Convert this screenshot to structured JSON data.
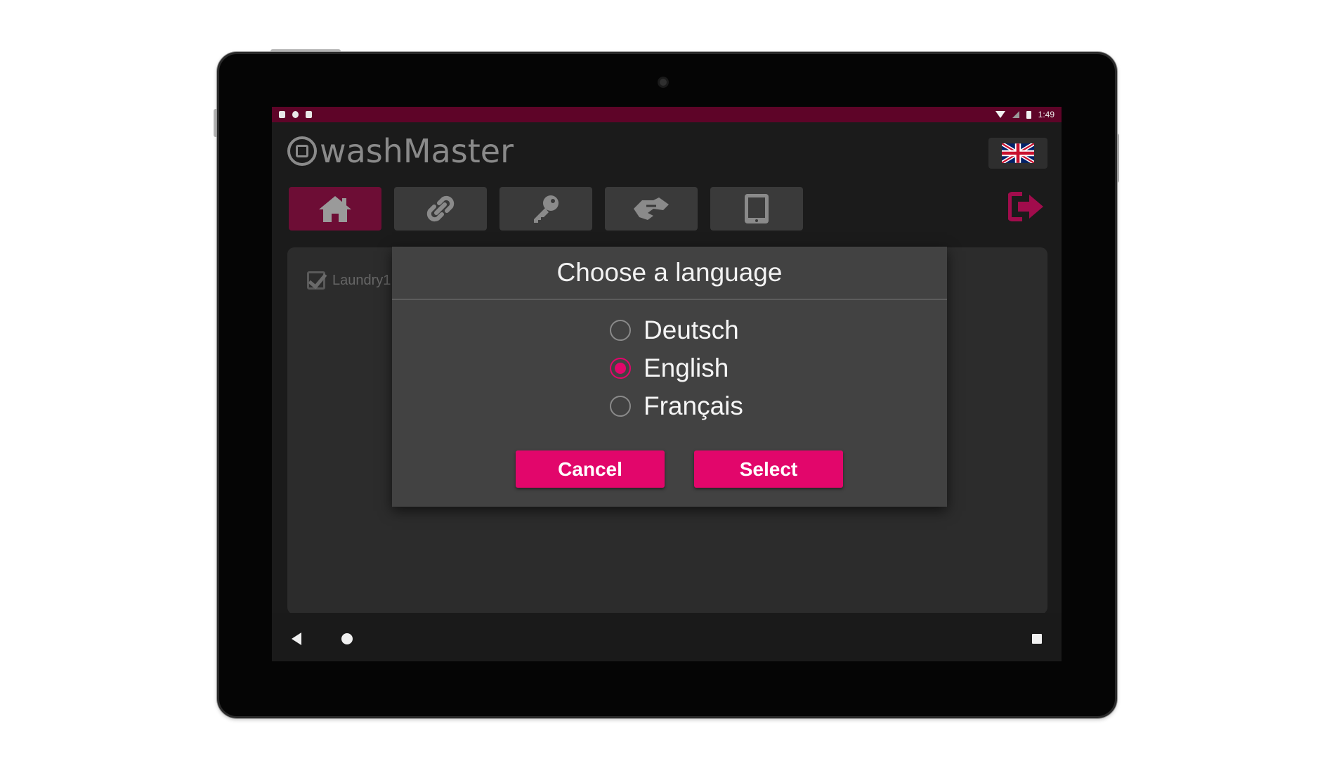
{
  "statusbar": {
    "time": "1:49"
  },
  "app": {
    "brand_name": "washMaster",
    "language_flag": "uk-flag-icon",
    "nav": [
      {
        "name": "home",
        "icon": "home-icon",
        "active": true
      },
      {
        "name": "link",
        "icon": "link-icon",
        "active": false
      },
      {
        "name": "key",
        "icon": "key-icon",
        "active": false
      },
      {
        "name": "transfer",
        "icon": "handshake-icon",
        "active": false
      },
      {
        "name": "tablet",
        "icon": "tablet-icon",
        "active": false
      }
    ],
    "logout_icon": "logout-icon",
    "laundry_label": "Laundry1"
  },
  "dialog": {
    "title": "Choose a language",
    "options": [
      {
        "label": "Deutsch",
        "selected": false
      },
      {
        "label": "English",
        "selected": true
      },
      {
        "label": "Français",
        "selected": false
      }
    ],
    "cancel_label": "Cancel",
    "select_label": "Select"
  },
  "colors": {
    "accent": "#e2066b",
    "statusbar": "#5e0428",
    "nav_active": "#6d0d35",
    "dialog_bg": "#424242"
  }
}
